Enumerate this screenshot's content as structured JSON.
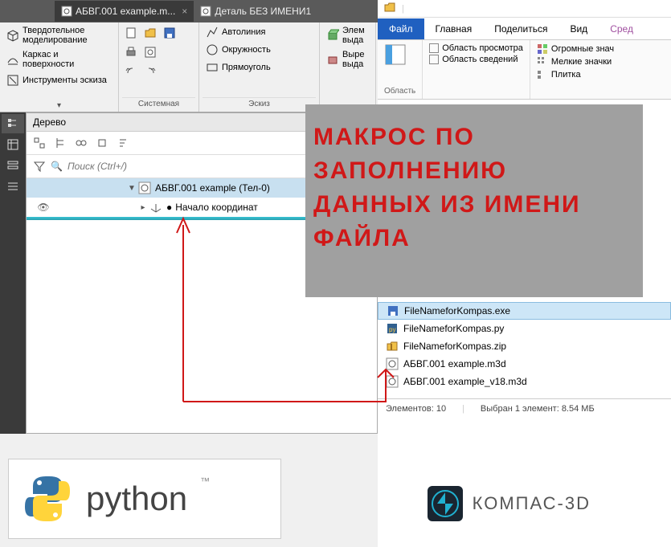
{
  "tabs": [
    {
      "label": "АБВГ.001 example.m...",
      "active": true
    },
    {
      "label": "Деталь БЕЗ ИМЕНИ1",
      "active": false
    }
  ],
  "modes": {
    "solid": "Твердотельное моделирование",
    "surface": "Каркас и поверхности",
    "sketch": "Инструменты эскиза"
  },
  "groups": {
    "system": "Системная",
    "sketch": "Эскиз"
  },
  "sketch_tools": {
    "autoline": "Автолиния",
    "circle": "Окружность",
    "rect": "Прямоуголь"
  },
  "elem_tools": {
    "elem": "Элем",
    "extrude": "выда",
    "cut": "Выре",
    "cut2": "выда"
  },
  "tree": {
    "title": "Дерево",
    "search_placeholder": "Поиск (Ctrl+/)",
    "root": "АБВГ.001 example (Тел-0)",
    "origin": "Начало координат"
  },
  "explorer": {
    "menu_file": "Файл",
    "tab_main": "Главная",
    "tab_share": "Поделиться",
    "tab_view": "Вид",
    "tab_tools": "Сред",
    "ribbon_region": "Область",
    "ribbon_preview": "Область просмотра",
    "ribbon_details": "Область сведений",
    "ribbon_huge": "Огромные знач",
    "ribbon_small": "Мелкие значки",
    "ribbon_tiles": "Плитка",
    "files": [
      {
        "name": "FileNameforKompas.exe",
        "icon": "exe",
        "sel": true
      },
      {
        "name": "FileNameforKompas.py",
        "icon": "py"
      },
      {
        "name": "FileNameforKompas.zip",
        "icon": "zip"
      },
      {
        "name": "АБВГ.001 example.m3d",
        "icon": "m3d"
      },
      {
        "name": "АБВГ.001 example_v18.m3d",
        "icon": "m3d"
      }
    ],
    "status_count": "Элементов: 10",
    "status_sel": "Выбран 1 элемент: 8.54 МБ"
  },
  "overlay": {
    "line1": "МАКРОС ПО",
    "line2": "ЗАПОЛНЕНИЮ",
    "line3": "ДАННЫХ ИЗ ИМЕНИ",
    "line4": "ФАЙЛА"
  },
  "python_label": "python",
  "kompas_label": "КОМПАС-3D"
}
